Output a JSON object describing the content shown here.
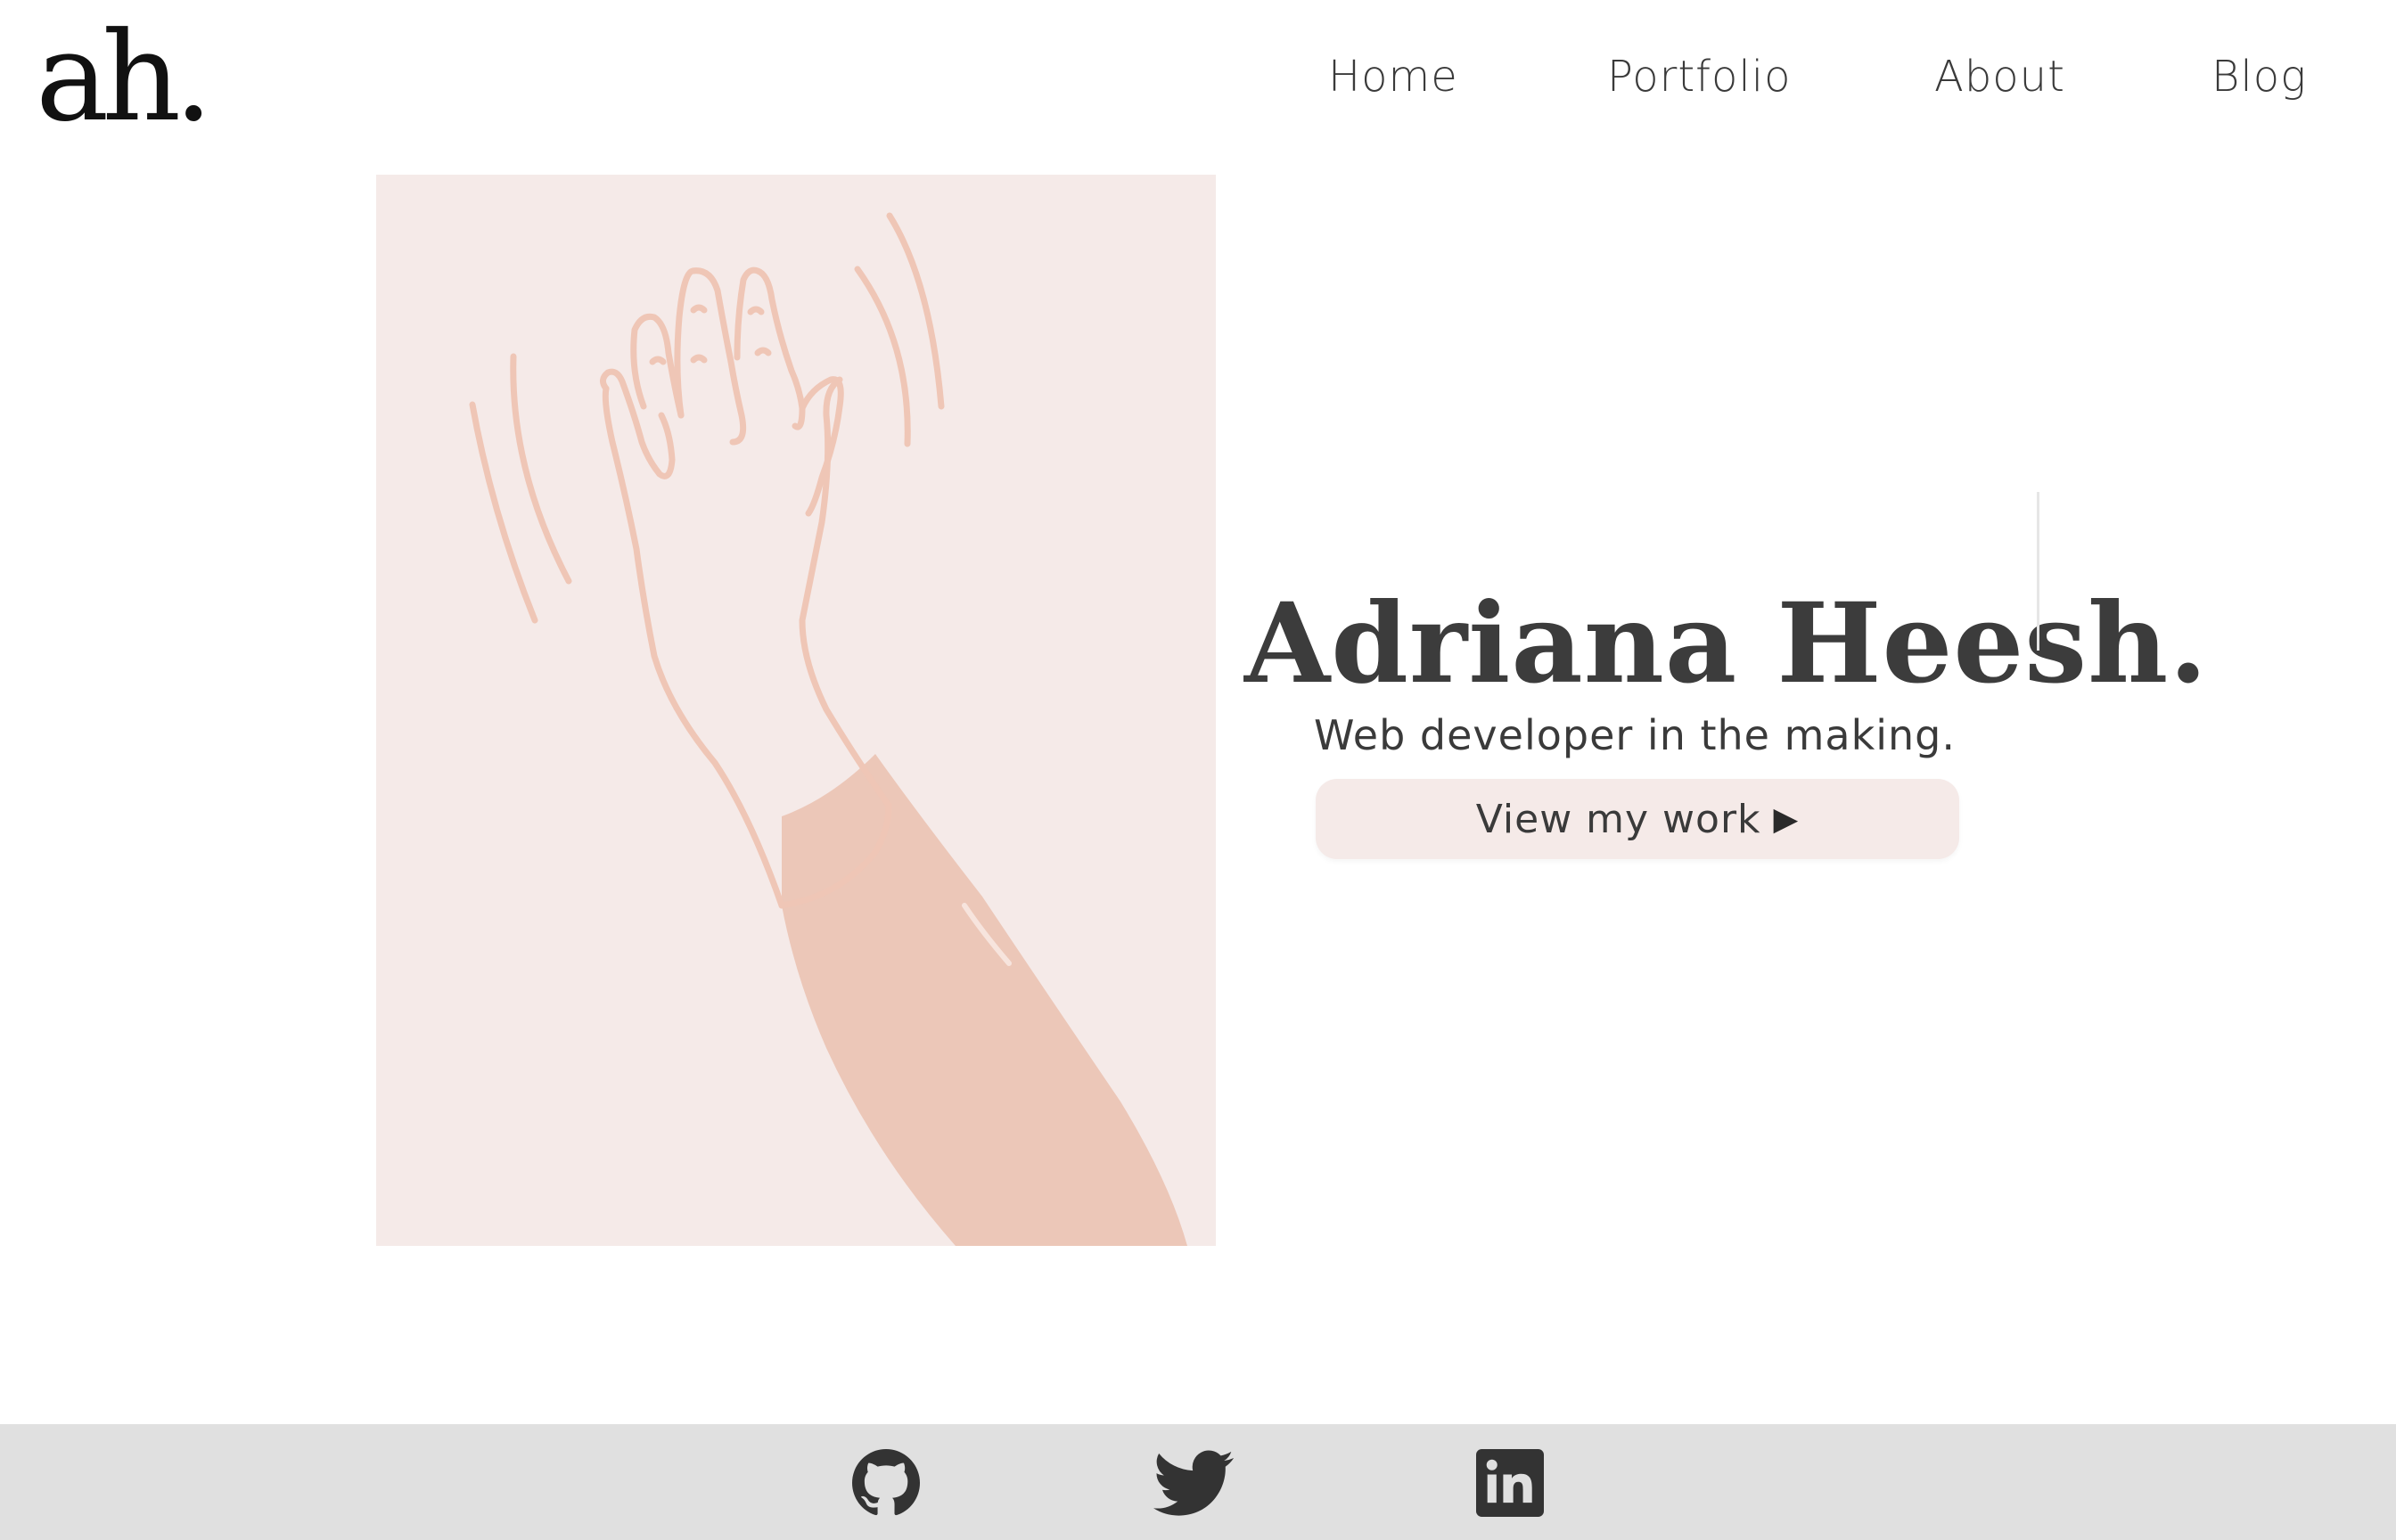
{
  "header": {
    "logo_text": "ah.",
    "nav": [
      {
        "label": "Home"
      },
      {
        "label": "Portfolio"
      },
      {
        "label": "About"
      },
      {
        "label": "Blog"
      }
    ]
  },
  "hero": {
    "illustration": "waving-hand-illustration",
    "name": "Adriana Heesh.",
    "tagline": "Web developer in the making.",
    "cta_label": "View my work",
    "cta_icon": "play-arrow-icon"
  },
  "footer": {
    "social": [
      {
        "icon": "github-icon"
      },
      {
        "icon": "twitter-icon"
      },
      {
        "icon": "linkedin-icon"
      }
    ]
  },
  "colors": {
    "panel_bg": "#f5eae8",
    "skin_line": "#efc6b6",
    "sleeve": "#ecc7b8",
    "text": "#3a3a3a",
    "footer_bg": "#e0e0e0"
  }
}
